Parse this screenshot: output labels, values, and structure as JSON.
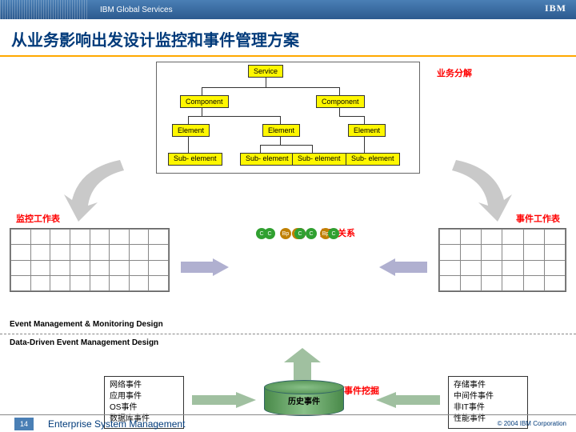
{
  "header": {
    "org": "IBM Global Services",
    "logo": "IBM"
  },
  "title": "从业务影响出发设计监控和事件管理方案",
  "tree": {
    "service": "Service",
    "decomp_label": "业务分解",
    "component": "Component",
    "element": "Element",
    "sub": "Sub-\nelement"
  },
  "labels": {
    "left": "监控工作表",
    "right": "事件工作表",
    "relation": "关联关系",
    "mining": "事件挖掘"
  },
  "sections": {
    "s1": "Event Management & Monitoring Design",
    "s2": "Data-Driven Event Management Design"
  },
  "event_sources": [
    "网络事件",
    "应用事件",
    "OS事件",
    "数据库事件"
  ],
  "event_targets": [
    "存储事件",
    "中间件事件",
    "非IT事件",
    "性能事件"
  ],
  "history": "历史事件",
  "dots": {
    "p": "P",
    "c": "C",
    "b": "Bp"
  },
  "footer": {
    "page": "14",
    "title": "Enterprise System Management",
    "copyright": "© 2004 IBM Corporation"
  }
}
